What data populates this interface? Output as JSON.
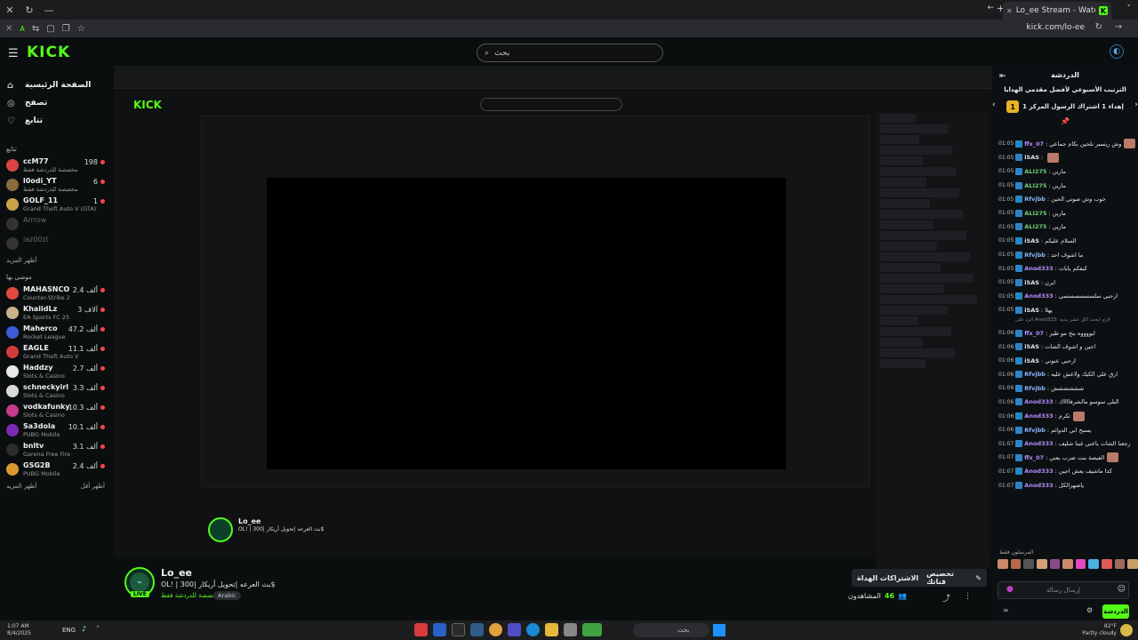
{
  "browser": {
    "tab_title": "Lo_ee Stream - Watch Live on K",
    "url": "kick.com/lo-ee"
  },
  "header": {
    "logo": "KICK",
    "search_placeholder": "بحث"
  },
  "sidebar": {
    "nav": [
      {
        "label": "الصفحة الرئيسية",
        "icon": "home-icon"
      },
      {
        "label": "تصفح",
        "icon": "compass-icon"
      },
      {
        "label": "تتابع",
        "icon": "heart-icon"
      }
    ],
    "following_title": "تتابع",
    "following": [
      {
        "name": "ccM77",
        "sub": "مخصصة للدردشة فقط",
        "count": "198",
        "status": "live",
        "color": "#d94444"
      },
      {
        "name": "l0odi_YT",
        "sub": "مخصصة للدردشة فقط",
        "count": "6",
        "status": "live",
        "color": "#8a6a3e"
      },
      {
        "name": "GOLF_11",
        "sub": "Grand Theft Auto V (GTA)",
        "count": "1",
        "status": "live",
        "color": "#c9a24a"
      },
      {
        "name": "Arrrow",
        "sub": "",
        "count": "",
        "status": "offline",
        "color": "#333"
      },
      {
        "name": "iaz00zI",
        "sub": "",
        "count": "",
        "status": "offline",
        "color": "#333"
      }
    ],
    "show_more": "أظهر المزيد",
    "recommended_title": "موصى بها",
    "recommended": [
      {
        "name": "MAHASNCO",
        "sub": "Counter-Strike 2",
        "count": "2.4 ألف",
        "color": "#e04a3c"
      },
      {
        "name": "KhalidLz",
        "sub": "EA Sports FC 25",
        "count": "3 آلاف",
        "color": "#c9b18a"
      },
      {
        "name": "Maherco",
        "sub": "Rocket League",
        "count": "47.2 ألف",
        "color": "#3d5ad8"
      },
      {
        "name": "EAGLE",
        "sub": "Grand Theft Auto V",
        "count": "11.1 ألف",
        "color": "#d23c3c"
      },
      {
        "name": "Haddzy",
        "sub": "Slots & Casino",
        "count": "2.7 ألف",
        "color": "#e8e8e8"
      },
      {
        "name": "schneckyirl",
        "sub": "Slots & Casino",
        "count": "3.3 ألف",
        "color": "#d9d9d9"
      },
      {
        "name": "vodkafunky",
        "sub": "Slots & Casino",
        "count": "10.3 ألف",
        "color": "#c43b8e"
      },
      {
        "name": "Sa3dola",
        "sub": "PUBG Mobile",
        "count": "10.1 ألف",
        "color": "#7a2bb5"
      },
      {
        "name": "bnltv",
        "sub": "Garena Free Fire",
        "count": "3.1 ألف",
        "color": "#2d2d2d"
      },
      {
        "name": "GSG2B",
        "sub": "PUBG Mobile",
        "count": "2.4 ألف",
        "color": "#d89a2f"
      }
    ],
    "show_more_2": "أظهر المزيد",
    "show_less": "أظهر أقل"
  },
  "streamer": {
    "name": "Lo_ee",
    "title": "OL! | بث العرعه |تحويل أريكار |300$",
    "category": "مخصصة للدردشة فقط",
    "language": "Arabic",
    "live_badge": "LIVE",
    "subscribe_label": "الاشتراكات الهداة",
    "customize_label": "تخصيص قناتك",
    "viewers_label": "المشاهدون",
    "viewers_count": "46"
  },
  "chat": {
    "title": "الدردشة",
    "pinned": "الترتيب الأسبوعي لأفضل مقدمي الهدايا",
    "gift_text": "إهداء 1 اشتراك الرسول المركز 1",
    "gift_rank": "1",
    "messages": [
      {
        "time": "01:05",
        "user": "ffx_07",
        "text": "وش ريسبر نلحين بكام جماعي",
        "color": "#b38cff",
        "emote": true
      },
      {
        "time": "01:05",
        "user": "iSAS",
        "text": "",
        "color": "#e6e6e6",
        "emote": true
      },
      {
        "time": "01:05",
        "user": "ALI275",
        "text": "مارين",
        "color": "#6ed17a",
        "emote": false
      },
      {
        "time": "01:05",
        "user": "ALI275",
        "text": "مارين",
        "color": "#6ed17a",
        "emote": false
      },
      {
        "time": "01:05",
        "user": "Rfvjbb",
        "text": "خوب وش صوتي الحين",
        "color": "#8ab4ff",
        "emote": false
      },
      {
        "time": "01:05",
        "user": "ALI275",
        "text": "مارين",
        "color": "#6ed17a",
        "emote": false
      },
      {
        "time": "01:05",
        "user": "ALI275",
        "text": "مارين",
        "color": "#6ed17a",
        "emote": false
      },
      {
        "time": "01:05",
        "user": "iSAS",
        "text": "السلام عليكم",
        "color": "#e6e6e6",
        "emote": false
      },
      {
        "time": "01:05",
        "user": "Rfvjbb",
        "text": "ما اشوف احد",
        "color": "#8ab4ff",
        "emote": false
      },
      {
        "time": "01:05",
        "user": "Anod333",
        "text": "كيفكم يابات",
        "color": "#b38cff",
        "emote": false
      },
      {
        "time": "01:05",
        "user": "iSAS",
        "text": "ابرن",
        "color": "#e6e6e6",
        "emote": false
      },
      {
        "time": "01:05",
        "user": "Anod333",
        "text": "ارحبي سلسسسسسسي",
        "color": "#b38cff",
        "emote": false
      },
      {
        "time": "01:05",
        "user": "iSAS",
        "text": "يهلا",
        "color": "#e6e6e6",
        "emote": false
      },
      {
        "time": "01:06",
        "user": "ffx_07",
        "text": "ايووووه بنج مو طيز",
        "color": "#b38cff",
        "emote": false
      },
      {
        "time": "01:06",
        "user": "iSAS",
        "text": "اجين و اشوف الشات",
        "color": "#e6e6e6",
        "emote": false
      },
      {
        "time": "01:06",
        "user": "iSAS",
        "text": "ارحبي عنوني",
        "color": "#e6e6e6",
        "emote": false
      },
      {
        "time": "01:06",
        "user": "Rfvjbb",
        "text": "ارق على الكيك ولاعش عليه",
        "color": "#8ab4ff",
        "emote": false
      },
      {
        "time": "01:06",
        "user": "Rfvjbb",
        "text": "شششششش",
        "color": "#8ab4ff",
        "emote": false
      },
      {
        "time": "01:06",
        "user": "Anod333",
        "text": "البلى سوسو مالشرفااااك",
        "color": "#b38cff",
        "emote": false
      },
      {
        "time": "01:06",
        "user": "Anod333",
        "text": "تكرم",
        "color": "#b38cff",
        "emote": true
      },
      {
        "time": "01:06",
        "user": "Rfvjbb",
        "text": "يسبح ابي الدوائم",
        "color": "#8ab4ff",
        "emote": false
      },
      {
        "time": "01:07",
        "user": "Anod333",
        "text": "رجعنا الشات ياعني غبنا شليف",
        "color": "#b38cff",
        "emote": false
      },
      {
        "time": "01:07",
        "user": "ffx_07",
        "text": "الفيصة بنت ضرب يعني",
        "color": "#b38cff",
        "emote": true
      },
      {
        "time": "01:07",
        "user": "Anod333",
        "text": "كذا ماشيف يعش اجين",
        "color": "#b38cff",
        "emote": false
      },
      {
        "time": "01:07",
        "user": "Anod333",
        "text": "ياصهرالكل",
        "color": "#b38cff",
        "emote": false
      }
    ],
    "reply_note": "الرد على Anod333: لازم ابحث اكل عشر بديه",
    "senders_title": "المرسلون فقط",
    "input_placeholder": "إرسال رسالة",
    "send_label": "الدردشة"
  },
  "taskbar": {
    "time": "1:07 AM",
    "date": "8/4/2025",
    "lang": "ENG",
    "search": "بحث",
    "temp": "82°F",
    "weather": "Partly cloudy"
  },
  "colors": {
    "accent": "#53fc18",
    "bg": "#0b0e0f"
  }
}
